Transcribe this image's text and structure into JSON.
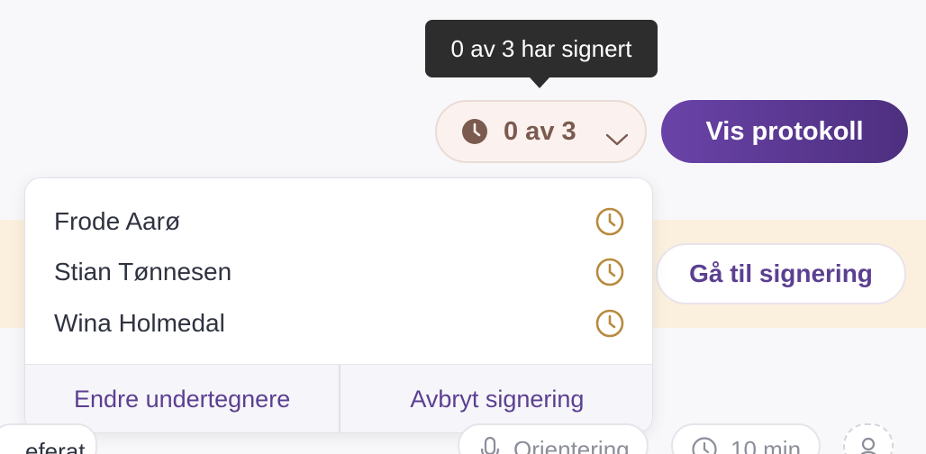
{
  "tooltip": {
    "text": "0 av 3 har signert"
  },
  "status": {
    "label": "0 av 3",
    "icon": "clock-icon",
    "chevron": "chevron-down-icon"
  },
  "vis_button": {
    "label": "Vis protokoll"
  },
  "banner": {
    "button_label": "Gå til signering"
  },
  "signers": [
    {
      "name": "Frode Aarø",
      "icon": "clock-icon"
    },
    {
      "name": "Stian Tønnesen",
      "icon": "clock-icon"
    },
    {
      "name": "Wina Holmedal",
      "icon": "clock-icon"
    }
  ],
  "dropdown_footer": {
    "edit_label": "Endre undertegnere",
    "cancel_label": "Avbryt signering"
  },
  "bottom": {
    "referat_label": "eferat",
    "orientering_label": "Orientering",
    "duration_label": "10 min"
  },
  "colors": {
    "accent": "#5b3f91",
    "pending_clock": "#b88a3e",
    "status_text": "#7b5a4f",
    "banner_bg": "#fbf0de"
  }
}
